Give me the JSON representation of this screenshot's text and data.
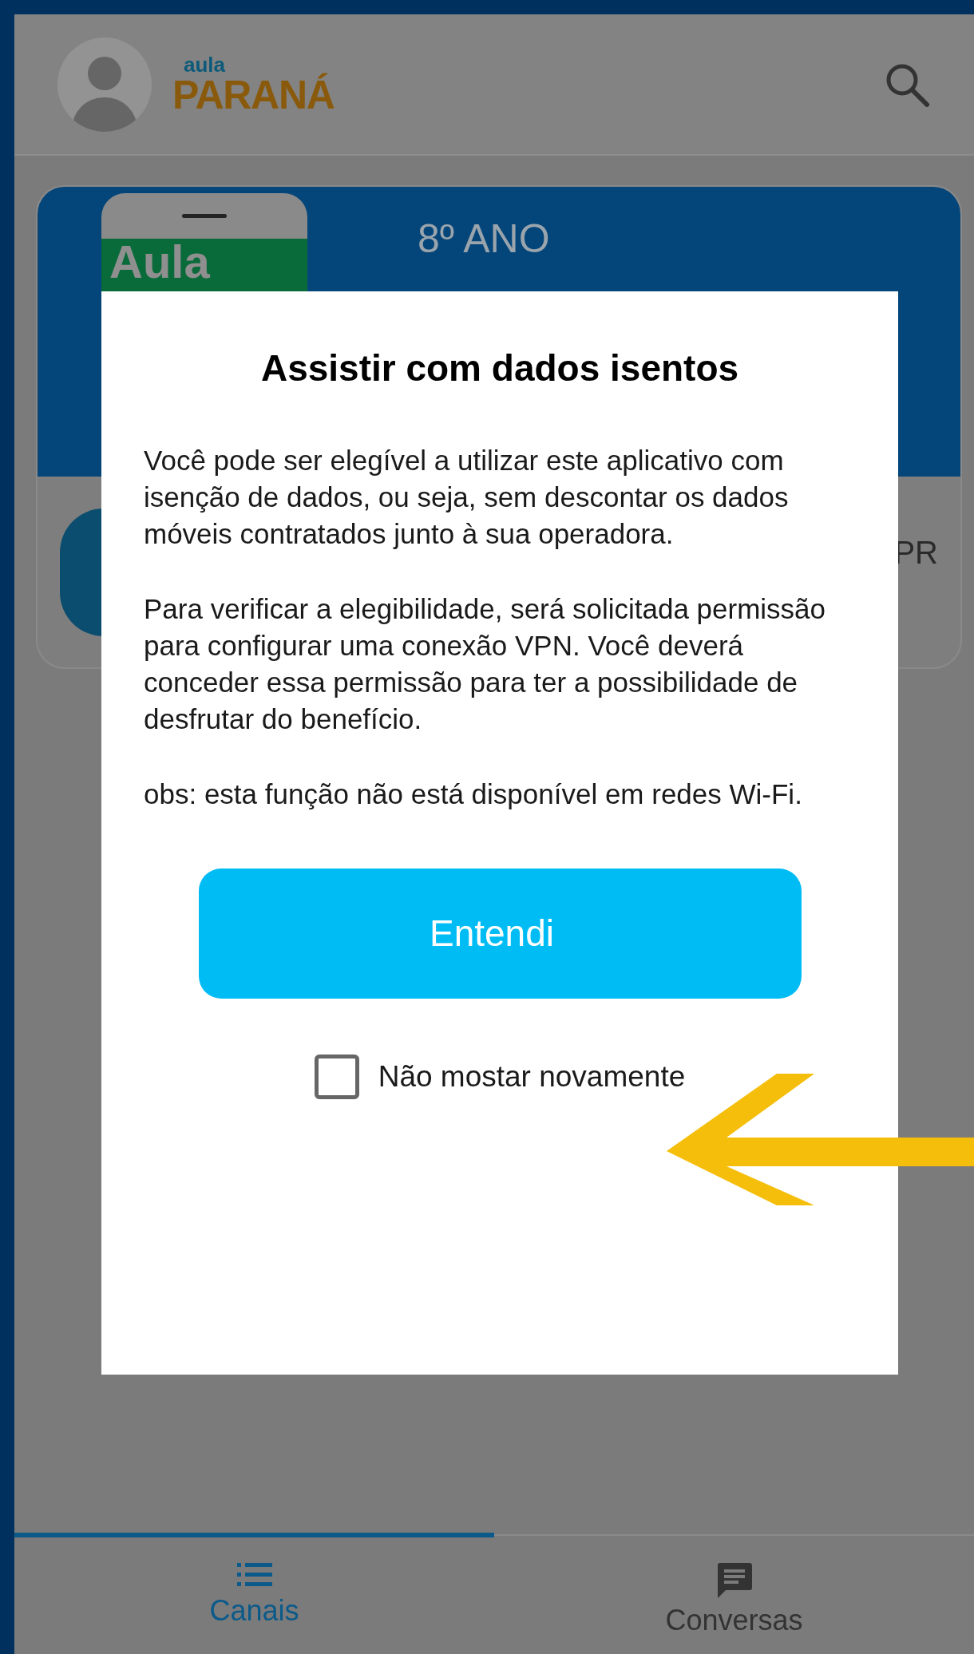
{
  "header": {
    "logo_top": "aula",
    "logo_bottom": "PARANÁ"
  },
  "card": {
    "phone_label": "Aula",
    "grade": "8º ANO",
    "footer_text": "PR"
  },
  "dialog": {
    "title": "Assistir com dados isentos",
    "paragraphs": [
      "Você pode ser elegível a utilizar este aplicativo com isenção de dados, ou seja, sem descontar os dados móveis contratados junto à sua operadora.",
      "Para verificar a elegibilidade, será solicitada permissão para configurar uma conexão VPN. Você deverá conceder essa permissão para ter a possibilidade de desfrutar do benefício.",
      "obs: esta função não está disponível em redes Wi-Fi."
    ],
    "button": "Entendi",
    "checkbox": {
      "label": "Não mostar novamente",
      "checked": false
    }
  },
  "tabs": [
    {
      "kind": "list",
      "label": "Canais",
      "selected": true
    },
    {
      "kind": "chat",
      "label": "Conversas",
      "selected": false
    }
  ]
}
